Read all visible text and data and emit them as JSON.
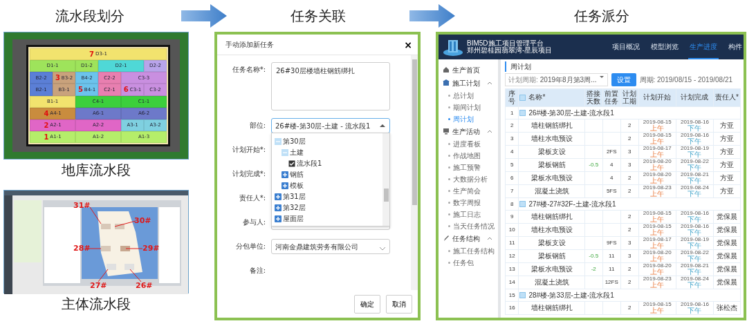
{
  "steps": [
    {
      "title": "流水段划分"
    },
    {
      "title": "任务关联"
    },
    {
      "title": "任务派分"
    }
  ],
  "basement": {
    "caption": "地库流水段",
    "rows": [
      [
        {
          "label": "D3-1",
          "color": "#f2e36e",
          "number": "7"
        }
      ],
      [
        {
          "label": "D1-1",
          "color": "#9ee35b"
        },
        {
          "label": "D1-2",
          "color": "#9ee35b"
        },
        {
          "label": "D2-1",
          "color": "#4fd8d6"
        },
        {
          "label": "D2-2",
          "color": "#b8a4ea"
        }
      ],
      [
        {
          "label": "B2-2",
          "color": "#5b7fd6"
        },
        {
          "label": "B3-2",
          "color": "#c9a27c",
          "number": "3"
        },
        {
          "label": "B4-2",
          "color": "#6cc3ec"
        },
        {
          "label": "C2-2",
          "color": "#e87fb0"
        },
        {
          "label": "C3-3",
          "color": "#c98fe0"
        }
      ],
      [
        {
          "label": "B2-1",
          "color": "#5b7fd6"
        },
        {
          "label": "B3-1",
          "color": "#c9a27c"
        },
        {
          "label": "B4-1",
          "color": "#6cc3ec",
          "number": "5"
        },
        {
          "label": "C2-1",
          "color": "#e87fb0"
        },
        {
          "label": "C3-1",
          "color": "#c98fe0",
          "number": "6"
        },
        {
          "label": "C3-2",
          "color": "#c98fe0"
        }
      ],
      [
        {
          "label": "B1-1",
          "color": "#f2e36e"
        },
        {
          "label": "C4-1",
          "color": "#3ccf3c"
        },
        {
          "label": "C1-1",
          "color": "#3ccf3c"
        }
      ],
      [
        {
          "label": "A4-1",
          "color": "#c98c3e",
          "number": "4"
        },
        {
          "label": "A6-1",
          "color": "#6d79c9"
        },
        {
          "label": "A6-2",
          "color": "#6d79c9"
        }
      ],
      [
        {
          "label": "A2-1",
          "color": "#e066c6",
          "number": "2"
        },
        {
          "label": "A2-2",
          "color": "#e066c6"
        },
        {
          "label": "A3-1",
          "color": "#7fd0e0"
        },
        {
          "label": "A3-2",
          "color": "#7fd0e0"
        }
      ],
      [
        {
          "label": "A1-1",
          "color": "#b5ee6a",
          "number": "1"
        },
        {
          "label": "A1-2",
          "color": "#b5ee6a"
        },
        {
          "label": "A1-3",
          "color": "#b5ee6a"
        }
      ]
    ]
  },
  "tower": {
    "caption": "主体流水段",
    "tags": [
      "31#",
      "30#",
      "28#",
      "29#",
      "27#",
      "26#"
    ]
  },
  "dialog": {
    "title": "手动添加新任务",
    "close": "×",
    "fields": [
      {
        "label": "任务名称*:",
        "kind": "textarea",
        "value": "26#30层楼墙柱钢筋绑扎"
      },
      {
        "label": "部位:",
        "kind": "select",
        "value": "26#楼-第30层-土建 - 流水段1",
        "expanded": true
      },
      {
        "label": "计划开始*:",
        "kind": "covered"
      },
      {
        "label": "计划完成*:",
        "kind": "covered"
      },
      {
        "label": "责任人*:",
        "kind": "covered"
      },
      {
        "label": "参与人:",
        "kind": "select",
        "expanded": false
      },
      {
        "label": "分包单位:",
        "kind": "select",
        "value": "河南金鼎建筑劳务有限公司",
        "expanded": false
      },
      {
        "label": "备注:",
        "kind": "covered"
      }
    ],
    "tree": [
      {
        "label": "第30层",
        "expanded": true,
        "children": [
          {
            "label": "土建",
            "expanded": true,
            "children": [
              {
                "label": "流水段1",
                "checked": true
              }
            ]
          },
          {
            "label": "钢筋",
            "expanded": false
          },
          {
            "label": "模板",
            "expanded": false
          }
        ]
      },
      {
        "label": "第31层",
        "expanded": false
      },
      {
        "label": "第32层",
        "expanded": false
      },
      {
        "label": "屋面层",
        "expanded": false
      }
    ],
    "buttons": [
      "确定",
      "取消"
    ]
  },
  "app": {
    "brand": [
      "BIM5D施工项目管理平台",
      "郑州碧桂园翡翠湾-星辰项目"
    ],
    "nav": [
      {
        "label": "项目概况",
        "selected": false
      },
      {
        "label": "模型浏览",
        "selected": false
      },
      {
        "label": "生产进度",
        "selected": true
      },
      {
        "label": "构件",
        "selected": false
      }
    ],
    "sidebar": [
      {
        "label": "生产首页"
      },
      {
        "label": "施工计划",
        "expanded": true,
        "children": [
          {
            "label": "总计划",
            "selected": false
          },
          {
            "label": "期间计划",
            "selected": false
          },
          {
            "label": "周计划",
            "selected": true
          }
        ]
      },
      {
        "label": "生产活动",
        "expanded": true,
        "children": [
          {
            "label": "进度看板",
            "selected": false
          },
          {
            "label": "作战地图",
            "selected": false
          },
          {
            "label": "施工预警",
            "selected": false
          },
          {
            "label": "大数据分析",
            "selected": false
          },
          {
            "label": "生产简会",
            "selected": false
          },
          {
            "label": "数字周报",
            "selected": false
          },
          {
            "label": "施工日志",
            "selected": false
          },
          {
            "label": "当天任务情况",
            "selected": false
          }
        ]
      },
      {
        "label": "任务结构",
        "expanded": true,
        "children": [
          {
            "label": "施工任务结构",
            "selected": false
          },
          {
            "label": "任务包",
            "selected": false
          }
        ]
      }
    ],
    "page_title": "周计划",
    "filter": {
      "label": "计划周期:",
      "value": "2019年8月第3周...",
      "button": "设置",
      "range": "周期: 2019/08/15 - 2019/08/21"
    },
    "select_all": {
      "checked": false
    },
    "columns": [
      "序号",
      "名称*",
      "搭接天数",
      "前置任务",
      "计划工期",
      "计划开始",
      "计划完成",
      "责任人*"
    ],
    "rows": [
      {
        "kind": "group",
        "no": "1",
        "name": "26#楼-第30层-土建-流水段1",
        "checked": false
      },
      {
        "kind": "task",
        "no": "2",
        "name": "墙柱钢筋绑扎",
        "duration": "2",
        "start": "2019-08-15",
        "start_half": "上午",
        "finish": "2019-08-16",
        "finish_half": "下午",
        "owner": "方亚"
      },
      {
        "kind": "task",
        "no": "3",
        "name": "墙柱水电预设",
        "duration": "2",
        "start": "2019-08-15",
        "start_half": "上午",
        "finish": "2019-08-16",
        "finish_half": "下午",
        "owner": "方亚"
      },
      {
        "kind": "task",
        "no": "4",
        "name": "梁板支设",
        "pred": "2FS",
        "duration": "3",
        "start": "2019-08-17",
        "start_half": "上午",
        "finish": "2019-08-19",
        "finish_half": "下午",
        "owner": "方亚"
      },
      {
        "kind": "task",
        "no": "5",
        "name": "梁板钢筋",
        "lag": "-0.5",
        "pred": "4",
        "duration": "3",
        "start": "2019-08-20",
        "start_half": "上午",
        "finish": "2019-08-22",
        "finish_half": "下午",
        "owner": "方亚"
      },
      {
        "kind": "task",
        "no": "6",
        "name": "梁板水电预设",
        "pred": "4",
        "duration": "2",
        "start": "2019-08-20",
        "start_half": "上午",
        "finish": "2019-08-21",
        "finish_half": "下午",
        "owner": "方亚"
      },
      {
        "kind": "task",
        "no": "7",
        "name": "混凝土浇筑",
        "pred": "5FS",
        "duration": "2",
        "start": "2019-08-23",
        "start_half": "上午",
        "finish": "2019-08-24",
        "finish_half": "下午",
        "owner": "方亚"
      },
      {
        "kind": "group",
        "no": "8",
        "name": "27#楼-27#32F-土建-流水段1",
        "checked": false
      },
      {
        "kind": "task",
        "no": "9",
        "name": "墙柱钢筋绑扎",
        "duration": "2",
        "start": "2019-08-15",
        "start_half": "上午",
        "finish": "2019-08-16",
        "finish_half": "下午",
        "owner": "党保晨"
      },
      {
        "kind": "task",
        "no": "10",
        "name": "墙柱水电预设",
        "duration": "2",
        "start": "2019-08-15",
        "start_half": "上午",
        "finish": "2019-08-16",
        "finish_half": "下午",
        "owner": "党保晨"
      },
      {
        "kind": "task",
        "no": "11",
        "name": "梁板支设",
        "pred": "9FS",
        "duration": "3",
        "start": "2019-08-17",
        "start_half": "上午",
        "finish": "2019-08-19",
        "finish_half": "下午",
        "owner": "党保晨"
      },
      {
        "kind": "task",
        "no": "12",
        "name": "梁板钢筋",
        "lag": "-0.5",
        "pred": "11",
        "duration": "3",
        "start": "2019-08-20",
        "start_half": "上午",
        "finish": "2019-08-22",
        "finish_half": "下午",
        "owner": "党保晨"
      },
      {
        "kind": "task",
        "no": "13",
        "name": "梁板水电预设",
        "lag": "-2",
        "pred": "11",
        "duration": "2",
        "start": "2019-08-20",
        "start_half": "上午",
        "finish": "2019-08-21",
        "finish_half": "下午",
        "owner": "党保晨"
      },
      {
        "kind": "task",
        "no": "14",
        "name": "混凝土浇筑",
        "pred": "12FS",
        "duration": "2",
        "start": "2019-08-23",
        "start_half": "上午",
        "finish": "2019-08-24",
        "finish_half": "下午",
        "owner": "党保晨"
      },
      {
        "kind": "group",
        "no": "15",
        "name": "28#楼-第33层-土建-流水段1",
        "checked": false
      },
      {
        "kind": "task",
        "no": "16",
        "name": "墙柱钢筋绑扎",
        "duration": "2",
        "start": "2019-08-15",
        "start_half": "上午",
        "finish": "2019-08-16",
        "finish_half": "下午",
        "owner": "张松杰"
      }
    ]
  }
}
